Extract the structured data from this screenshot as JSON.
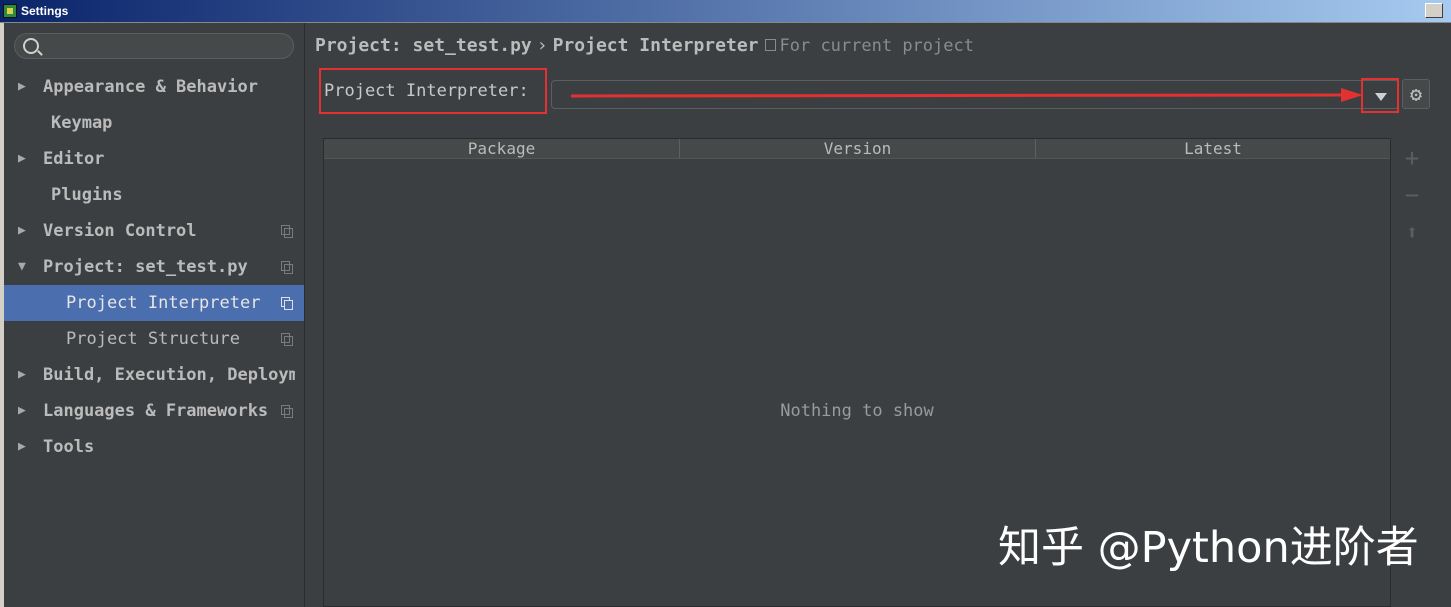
{
  "window": {
    "title": "Settings"
  },
  "search": {
    "value": "",
    "placeholder": ""
  },
  "sidebar": {
    "items": [
      {
        "label": "Appearance & Behavior",
        "arrow": "▶"
      },
      {
        "label": "Keymap"
      },
      {
        "label": "Editor",
        "arrow": "▶"
      },
      {
        "label": "Plugins"
      },
      {
        "label": "Version Control",
        "arrow": "▶"
      },
      {
        "label": "Project: set_test.py",
        "arrow": "▼"
      },
      {
        "label": "Project Interpreter"
      },
      {
        "label": "Project Structure"
      },
      {
        "label": "Build, Execution, Deployment",
        "arrow": "▶"
      },
      {
        "label": "Languages & Frameworks",
        "arrow": "▶"
      },
      {
        "label": "Tools",
        "arrow": "▶"
      }
    ],
    "selected": "Project Interpreter"
  },
  "breadcrumb": {
    "project": "Project: set_test.py",
    "separator": "›",
    "page": "Project Interpreter",
    "scope": "For current project"
  },
  "interpreter": {
    "label": "Project Interpreter:",
    "value": ""
  },
  "table": {
    "columns": [
      "Package",
      "Version",
      "Latest"
    ],
    "rows": [],
    "empty_text": "Nothing to show"
  },
  "icons": {
    "gear": "gear-icon",
    "dropdown": "chevron-down-icon",
    "add": "plus-icon",
    "remove": "minus-icon",
    "upgrade": "up-arrow-icon"
  },
  "colors": {
    "background": "#3c3f41",
    "selection": "#4b6eaf",
    "annotation": "#e33030"
  },
  "watermark": "知乎 @Python进阶者"
}
